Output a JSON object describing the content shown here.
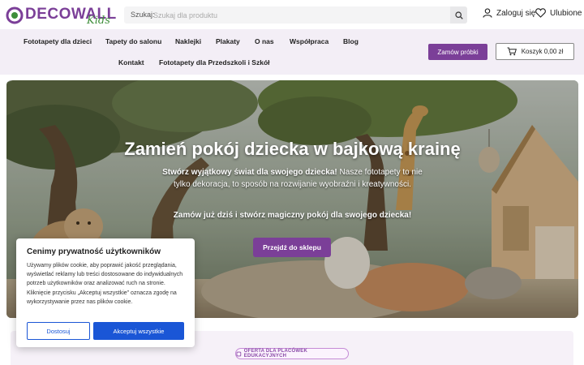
{
  "brand": {
    "name": "DECOWALL",
    "sub": "Kids",
    "accent": "#7b3f98",
    "logo_green": "#3e8e3a"
  },
  "search": {
    "label": "Szukaj:",
    "placeholder": "Szukaj dla produktu"
  },
  "header": {
    "login": "Zaloguj się",
    "favorites": "Ulubione"
  },
  "nav": {
    "items": [
      "Fototapety dla dzieci",
      "Tapety do salonu",
      "Naklejki",
      "Plakaty",
      "O nas",
      "Współpraca",
      "Blog",
      "Kontakt",
      "Fototapety dla Przedszkoli i Szkół"
    ],
    "sample_button": "Zamów próbki",
    "cart": "Koszyk 0,00 zł"
  },
  "hero": {
    "title": "Zamień pokój dziecka w bajkową krainę",
    "line1_bold": "Stwórz wyjątkowy świat dla swojego dziecka!",
    "line1_rest": " Nasze fototapety to nie",
    "line2": "tylko dekoracja, to sposób na rozwijanie wyobraźni i kreatywności.",
    "cta": "Zamów już dziś i stwórz magiczny pokój dla swojego dziecka!",
    "button": "Przejdź do sklepu"
  },
  "cookie": {
    "title": "Cenimy prywatność użytkowników",
    "text": "Używamy plików cookie, aby poprawić jakość przeglądania, wyświetlać reklamy lub treści dostosowane do indywidualnych potrzeb użytkowników oraz analizować ruch na stronie. Kliknięcie przycisku „Akceptuj wszystkie” oznacza zgodę na wykorzystywanie przez nas plików cookie.",
    "customize": "Dostosuj",
    "accept": "Akceptuj wszystkie",
    "button_color": "#1a56d6"
  },
  "promo": {
    "badge": "OFERTA DLA PLACÓWEK EDUKACYJNYCH"
  }
}
